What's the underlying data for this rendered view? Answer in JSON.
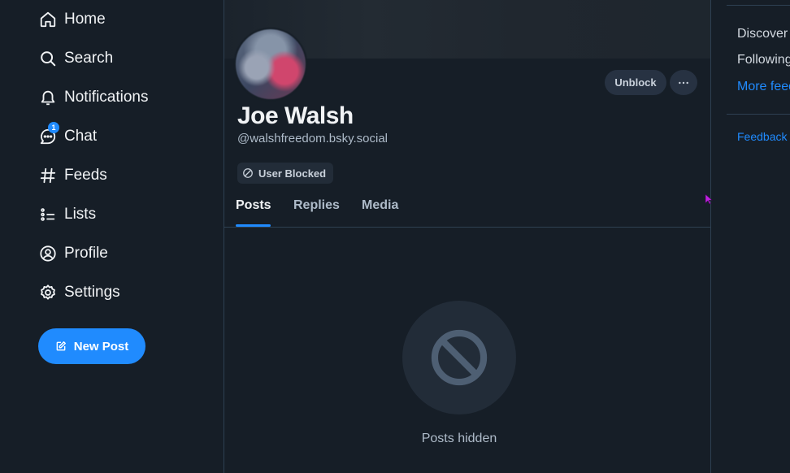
{
  "nav": {
    "items": [
      {
        "label": "Home",
        "icon": "home-icon"
      },
      {
        "label": "Search",
        "icon": "search-icon"
      },
      {
        "label": "Notifications",
        "icon": "bell-icon"
      },
      {
        "label": "Chat",
        "icon": "chat-icon",
        "badge": "1"
      },
      {
        "label": "Feeds",
        "icon": "hash-icon"
      },
      {
        "label": "Lists",
        "icon": "list-icon"
      },
      {
        "label": "Profile",
        "icon": "user-circle-icon"
      },
      {
        "label": "Settings",
        "icon": "gear-icon"
      }
    ],
    "new_post_label": "New Post"
  },
  "profile": {
    "name": "Joe Walsh",
    "handle": "@walshfreedom.bsky.social",
    "unblock_label": "Unblock",
    "more_label": "···",
    "blocked_label": "User Blocked",
    "tabs": [
      "Posts",
      "Replies",
      "Media"
    ],
    "active_tab": "Posts",
    "empty_message": "Posts hidden"
  },
  "right": {
    "discover": "Discover",
    "following": "Following",
    "more_feeds": "More feeds",
    "feedback": "Feedback"
  },
  "colors": {
    "background": "#161e27",
    "accent": "#208bfe",
    "divider": "#2e4052",
    "muted_text": "#aebbc9"
  }
}
